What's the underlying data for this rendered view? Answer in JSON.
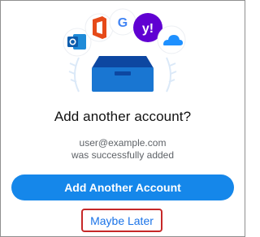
{
  "dialog": {
    "title": "Add another account?",
    "email": "user@example.com",
    "status": "was successfully added",
    "primary_button_label": "Add Another Account",
    "secondary_button_label": "Maybe Later"
  },
  "illustration": {
    "icons": [
      "outlook-icon",
      "office-icon",
      "google-icon",
      "yahoo-icon",
      "onedrive-icon",
      "inbox-tray-icon"
    ],
    "google_letter": "G",
    "yahoo_letter": "y!"
  },
  "colors": {
    "primary": "#1587ea",
    "link": "#1a73e8",
    "highlight_border": "#c62828"
  }
}
